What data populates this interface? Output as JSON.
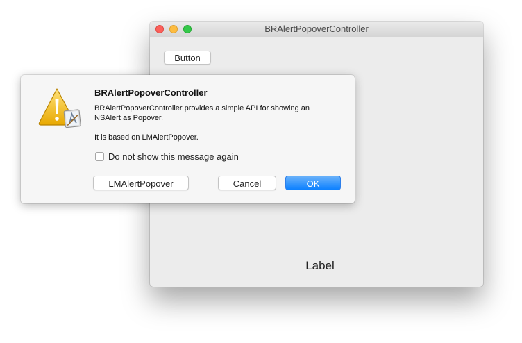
{
  "window": {
    "title": "BRAlertPopoverController",
    "button_label": "Button",
    "label_text": "Label"
  },
  "alert": {
    "icon": "caution-warning-icon",
    "title": "BRAlertPopoverController",
    "message": "BRAlertPopoverController provides a simple API for showing an NSAlert as Popover.",
    "informative": "It is based on LMAlertPopover.",
    "suppression_label": "Do not show this message again",
    "suppression_checked": false,
    "buttons": {
      "alternate": "LMAlertPopover",
      "cancel": "Cancel",
      "ok": "OK"
    }
  },
  "colors": {
    "accent": "#1a87ff",
    "close": "#fc605b",
    "minimize": "#fdbc40",
    "zoom": "#34c84a",
    "warning": "#f5c518"
  }
}
